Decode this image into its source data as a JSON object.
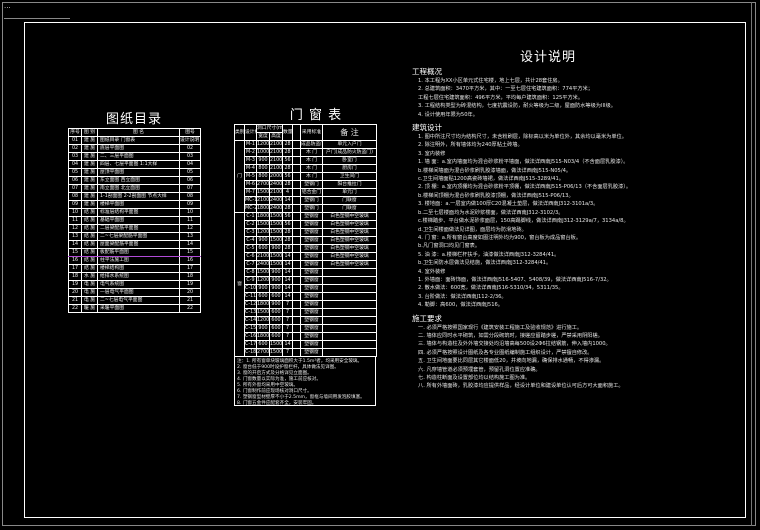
{
  "corner_text": "...",
  "catalog": {
    "title": "图纸目录",
    "headers": [
      "序号",
      "图 别",
      "图    名",
      "图号"
    ],
    "rows": [
      [
        "01",
        "建 施",
        "图纸目录  门窗表",
        "设计说明 01"
      ],
      [
        "02",
        "建 施",
        "底层平面图",
        "02"
      ],
      [
        "03",
        "建 施",
        "二、三层平面图",
        "03"
      ],
      [
        "04",
        "建 施",
        "四层、七层平面图  1:1大样",
        "04"
      ],
      [
        "05",
        "建 施",
        "屋顶平面图",
        "05"
      ],
      [
        "06",
        "建 施",
        "东立面图  西立面图",
        "06"
      ],
      [
        "07",
        "建 施",
        "南立面图  北立面图",
        "07"
      ],
      [
        "08",
        "建 施",
        "1-1剖面图  2-2剖面图  节点大样",
        "08"
      ],
      [
        "09",
        "建 施",
        "楼梯平面图",
        "09"
      ],
      [
        "10",
        "结 施",
        "标准层结构平面图",
        "10"
      ],
      [
        "11",
        "结 施",
        "基础平面图",
        "11"
      ],
      [
        "12",
        "结 施",
        "二层梁配筋平面图",
        "12"
      ],
      [
        "13",
        "结 施",
        "二~七层梁配筋平面图",
        "13"
      ],
      [
        "14",
        "结 施",
        "屋面梁配筋平面图",
        "14"
      ],
      [
        "15",
        "结 施",
        "板配筋平面图",
        "15"
      ],
      [
        "16",
        "结 施",
        "柱平法施工图",
        "16"
      ],
      [
        "17",
        "结 施",
        "楼梯结构图",
        "17"
      ],
      [
        "18",
        "水 施",
        "给排水系统图",
        "18"
      ],
      [
        "19",
        "电 施",
        "电气系统图",
        "19"
      ],
      [
        "20",
        "电 施",
        "一层电气平面图",
        "20"
      ],
      [
        "21",
        "电 施",
        "二~七层电气平面图",
        "21"
      ],
      [
        "22",
        "暖 施",
        "采暖平面图",
        "22"
      ]
    ]
  },
  "doors": {
    "title": "门 窗 表",
    "headers": [
      "类别",
      "设计编号",
      "洞口尺寸(mm)",
      "宽度",
      "高度",
      "数量",
      "采用标准",
      "备    注"
    ],
    "rows": [
      [
        "门",
        "M-1",
        "1200",
        "2100",
        "28",
        "",
        "成品防盗门",
        "单元入户门"
      ],
      [
        "",
        "M-2",
        "1000",
        "2100",
        "28",
        "",
        "木 门",
        "户门(成品防火防盗门)"
      ],
      [
        "",
        "M-3",
        "900",
        "2100",
        "56",
        "",
        "木 门",
        "卧室门"
      ],
      [
        "",
        "M-4",
        "800",
        "2100",
        "28",
        "",
        "木 门",
        "厨房门"
      ],
      [
        "",
        "M-5",
        "800",
        "2000",
        "56",
        "",
        "木 门",
        "卫生间门"
      ],
      [
        "",
        "M-6",
        "2700",
        "2400",
        "28",
        "",
        "塑钢门",
        "阳台推拉门"
      ],
      [
        "",
        "M-7",
        "1500",
        "2100",
        "4",
        "",
        "铝合金门",
        "单元门"
      ],
      [
        "",
        "MC-1",
        "2100",
        "2400",
        "14",
        "",
        "塑钢门",
        "门联窗"
      ],
      [
        "",
        "MC-2",
        "1800",
        "2400",
        "28",
        "",
        "塑钢门",
        "门联窗"
      ],
      [
        "窗",
        "C-1",
        "1800",
        "1500",
        "56",
        "",
        "塑钢窗",
        "白色塑钢中空玻璃"
      ],
      [
        "",
        "C-2",
        "1500",
        "1500",
        "56",
        "",
        "塑钢窗",
        "白色塑钢中空玻璃"
      ],
      [
        "",
        "C-3",
        "1200",
        "1500",
        "28",
        "",
        "塑钢窗",
        "白色塑钢中空玻璃"
      ],
      [
        "",
        "C-4",
        "900",
        "1500",
        "28",
        "",
        "塑钢窗",
        "白色塑钢中空玻璃"
      ],
      [
        "",
        "C-5",
        "600",
        "900",
        "28",
        "",
        "塑钢窗",
        "白色塑钢中空玻璃"
      ],
      [
        "",
        "C-6",
        "2100",
        "1500",
        "14",
        "",
        "塑钢窗",
        "白色塑钢中空玻璃"
      ],
      [
        "",
        "C-7",
        "2400",
        "1500",
        "14",
        "",
        "塑钢窗",
        "白色塑钢中空玻璃"
      ],
      [
        "",
        "C-8",
        "1500",
        "900",
        "14",
        "",
        "塑钢窗",
        ""
      ],
      [
        "",
        "C-9",
        "1200",
        "900",
        "14",
        "",
        "塑钢窗",
        ""
      ],
      [
        "",
        "C-10",
        "900",
        "900",
        "14",
        "",
        "塑钢窗",
        ""
      ],
      [
        "",
        "C-11",
        "600",
        "600",
        "14",
        "",
        "塑钢窗",
        ""
      ],
      [
        "",
        "C-12",
        "1800",
        "900",
        "7",
        "",
        "塑钢窗",
        ""
      ],
      [
        "",
        "C-13",
        "1500",
        "600",
        "7",
        "",
        "塑钢窗",
        ""
      ],
      [
        "",
        "C-14",
        "1200",
        "600",
        "7",
        "",
        "塑钢窗",
        ""
      ],
      [
        "",
        "C-15",
        "900",
        "600",
        "7",
        "",
        "塑钢窗",
        ""
      ],
      [
        "",
        "C-16",
        "1800",
        "600",
        "7",
        "",
        "塑钢窗",
        ""
      ],
      [
        "",
        "C-17",
        "600",
        "1500",
        "14",
        "",
        "塑钢窗",
        ""
      ],
      [
        "",
        "C-18",
        "2700",
        "1500",
        "7",
        "",
        "塑钢窗",
        ""
      ]
    ],
    "notes": [
      "注：1. 所有窗单块玻璃面积大于1.5m²者，均采用安全玻璃。",
      "    2. 窗台低于900时设护窗栏杆，具体做法见详图。",
      "    3. 窗的开启方式及分格详见立面图。",
      "    4. 门窗数量以实际为准，施工前应核对。",
      "    5. 所有外窗均采用中空玻璃。",
      "    6. 门窗制作前应现场核对洞口尺寸。",
      "    7. 塑钢窗型材壁厚不小于2.5mm，窗框与墙间用发泡胶填塞。",
      "    8. 门窗五金件应配套齐全，安装牢固。"
    ]
  },
  "design": {
    "title": "设计说明",
    "sections": [
      {
        "heading": "工程概况",
        "lines": [
          "1. 本工程为XX小区单元式住宅楼，地上七层，共计28套住房。",
          "2. 总建筑面积：3470平方米，其中：一至七层住宅建筑面积：774平方米；",
          "   工程七层住宅建筑面积：496平方米，平均每户建筑面积：125平方米。",
          "3. 工程结构类型为砖混结构，七度抗震设防，耐火等级为二级，屋面防水等级为III级。",
          "4. 设计使用年限为50年。"
        ]
      },
      {
        "heading": "建筑设计",
        "lines": [
          "1. 图中所注尺寸均为结构尺寸，未含粉刷层，除标高以米为单位外，其余均以毫米为单位。",
          "2. 除注明外，所有墙体均为240厚粘土砖墙。",
          "3. 室内装修",
          "   1. 墙  面：a.室内墙面均为混合砂浆粉平墙面，做法详西南J515-N03/4（不含面层乳胶漆）。",
          "              b.楼梯间墙面为混合砂浆刷乳胶漆墙面，做法详西南J515-N05/4。",
          "              c.卫生间墙面贴1200高瓷砖墙裙，做法详西南J515-3289/41。",
          "   2. 顶  棚：a.室内顶棚均为混合砂浆粉平顶棚，做法详西南J515-P06/13（不含面层乳胶漆）。",
          "              b.楼梯间顶棚为混合砂浆刷乳胶漆顶棚，做法详西南J515-P06/13。",
          "   3. 楼地面：a.一层室内做100厚C20混凝土垫层，做法详西南J312-3101a/3。",
          "              b.二至七层楼面均为水泥砂浆楼面，做法详西南J312-3102/3。",
          "              c.楼梯踏步、平台做水泥砂浆面层，150高踢脚线，做法详西南J312-3129a/7，3134a/8。",
          "              d.卫生间楼面做法见详图，面层均为防滑地砖。",
          "   4. 门  窗：a.所有窗台高度如图注明外均为900，窗台板为成品窗台板。",
          "              b.凡门窗洞口均见门窗表。",
          "   5. 油  漆：a.楼梯栏杆扶手，油漆做法详西南J312-3284/41。",
          "              b.卫生间防水层做法见结施，做法详西南J312-3284/41。",
          "4. 室外装修",
          "   1. 外墙面：面砖饰面，做法详西南J516-5407、5408/39，做法详西南J516-7/32。",
          "   2. 散水做法：600宽，做法详西南J516-5310/34，5311/35。",
          "   3. 台阶做法：做法详西南J112-2/36。",
          "   4. 勒脚：高600，做法详西南J516。"
        ]
      },
      {
        "heading": "施工要求",
        "lines": [
          "一. 必须严格按照国家现行《建筑安装工程施工及验收规范》进行施工。",
          "二. 墙体应同时水平砌筑，如需分段砌筑时，接槎应留踏步槎，严禁采用阴阳槎。",
          "三. 墙体与构造柱及外外墙交接处均沿墙高每500设2Φ6拉结钢筋，伸入墙内1000。",
          "四. 必须严格按照设计图纸及各专业图纸编制施工组织设计，严禁擅自修改。",
          "五. 卫生间地面要比同层其它楼面低20，并坡向地漏，确保排水通畅，不得渗漏。",
          "六. 凡穿墙管道必须预埋套管，预留孔洞位置应准确。",
          "七. 构造柱断面及设置部位均以结构施工图为准。",
          "八. 所有外墙面砖，乳胶漆均应提供样品，经设计单位和建设单位认可后方可大面积施工。"
        ]
      }
    ]
  },
  "colors": {
    "background": "#000000",
    "line": "#ffffff",
    "highlight": "#b24bd8",
    "warning": "#ff4a4a"
  }
}
